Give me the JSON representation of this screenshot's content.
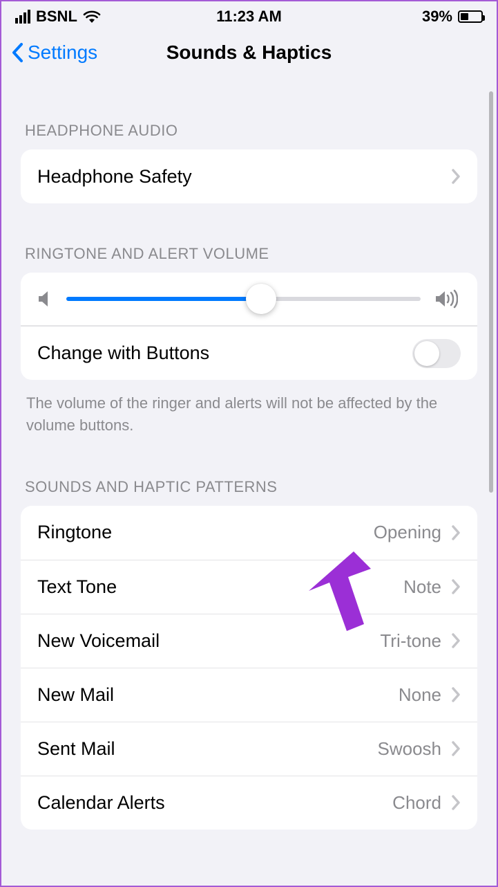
{
  "status": {
    "carrier": "BSNL",
    "time": "11:23 AM",
    "battery_pct": "39%",
    "battery_fill_pct": 39
  },
  "nav": {
    "back_label": "Settings",
    "title": "Sounds & Haptics"
  },
  "sections": {
    "headphone_audio": {
      "header": "HEADPHONE AUDIO",
      "rows": {
        "safety": "Headphone Safety"
      }
    },
    "ringtone_volume": {
      "header": "RINGTONE AND ALERT VOLUME",
      "slider_pct": 55,
      "change_buttons_label": "Change with Buttons",
      "change_buttons_on": false,
      "footer": "The volume of the ringer and alerts will not be affected by the volume buttons."
    },
    "sound_patterns": {
      "header": "SOUNDS AND HAPTIC PATTERNS",
      "items": [
        {
          "label": "Ringtone",
          "value": "Opening"
        },
        {
          "label": "Text Tone",
          "value": "Note"
        },
        {
          "label": "New Voicemail",
          "value": "Tri-tone"
        },
        {
          "label": "New Mail",
          "value": "None"
        },
        {
          "label": "Sent Mail",
          "value": "Swoosh"
        },
        {
          "label": "Calendar Alerts",
          "value": "Chord"
        }
      ]
    }
  }
}
